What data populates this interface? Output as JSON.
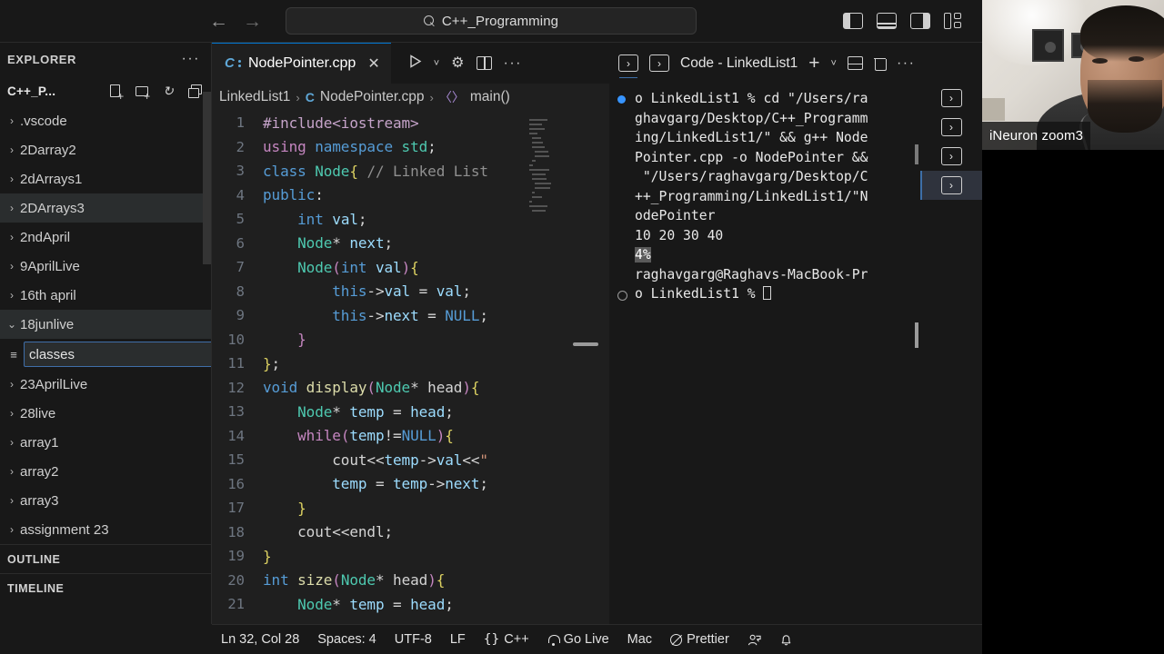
{
  "titlebar": {
    "back_label": "←",
    "forward_label": "→",
    "search_value": "C++_Programming",
    "search_icon": "search-icon",
    "layout_buttons": [
      "toggle-primary-sidebar",
      "toggle-panel",
      "toggle-secondary-sidebar",
      "customize-layout"
    ]
  },
  "sidebar": {
    "title": "EXPLORER",
    "more_label": "···",
    "project_name": "C++_P...",
    "actions": [
      "new-file",
      "new-folder",
      "refresh-explorer",
      "collapse-folders"
    ],
    "items": [
      {
        "label": ".vscode",
        "chevron": "›",
        "selected": false
      },
      {
        "label": "2Darray2",
        "chevron": "›",
        "selected": false
      },
      {
        "label": "2dArrays1",
        "chevron": "›",
        "selected": false
      },
      {
        "label": "2DArrays3",
        "chevron": "›",
        "selected": true
      },
      {
        "label": "2ndApril",
        "chevron": "›",
        "selected": false
      },
      {
        "label": "9AprilLive",
        "chevron": "›",
        "selected": false
      },
      {
        "label": "16th april",
        "chevron": "›",
        "selected": false
      },
      {
        "label": "18junlive",
        "chevron": "⌄",
        "selected": true
      }
    ],
    "new_item_input": {
      "value": "classes",
      "placeholder": "",
      "icon": "file-lines-icon"
    },
    "items_after": [
      {
        "label": "23AprilLive",
        "chevron": "›",
        "selected": false
      },
      {
        "label": "28live",
        "chevron": "›",
        "selected": false
      },
      {
        "label": "array1",
        "chevron": "›",
        "selected": false
      },
      {
        "label": "array2",
        "chevron": "›",
        "selected": false
      },
      {
        "label": "array3",
        "chevron": "›",
        "selected": false
      },
      {
        "label": "assignment 23",
        "chevron": "›",
        "selected": false
      }
    ],
    "sections": [
      "OUTLINE",
      "TIMELINE"
    ]
  },
  "editor": {
    "tab": {
      "label": "NodePointer.cpp",
      "icon": "cpp-file-icon",
      "close": "✕"
    },
    "actions": [
      "run-code",
      "run-dropdown",
      "settings-gear",
      "split-editor",
      "more-actions"
    ],
    "breadcrumb": [
      "LinkedList1",
      "NodePointer.cpp",
      "main()"
    ],
    "lines": [
      {
        "n": "1",
        "tokens": [
          {
            "t": "#include",
            "c": "k-pp"
          },
          {
            "t": "<iostream>",
            "c": "k-pp"
          }
        ]
      },
      {
        "n": "2",
        "tokens": [
          {
            "t": "using ",
            "c": "k-ctl"
          },
          {
            "t": "namespace ",
            "c": "k-kw"
          },
          {
            "t": "std",
            "c": "k-type"
          },
          {
            "t": ";",
            "c": "k-txt"
          }
        ]
      },
      {
        "n": "3",
        "tokens": [
          {
            "t": "class ",
            "c": "k-kw"
          },
          {
            "t": "Node",
            "c": "k-type"
          },
          {
            "t": "{",
            "c": "k-br"
          },
          {
            "t": " ",
            "c": "k-txt"
          },
          {
            "t": "// Linked List",
            "c": "k-cmt"
          }
        ]
      },
      {
        "n": "4",
        "tokens": [
          {
            "t": "public",
            "c": "k-kw"
          },
          {
            "t": ":",
            "c": "k-txt"
          }
        ]
      },
      {
        "n": "5",
        "tokens": [
          {
            "t": "    ",
            "c": "k-txt"
          },
          {
            "t": "int ",
            "c": "k-kw"
          },
          {
            "t": "val",
            "c": "k-var"
          },
          {
            "t": ";",
            "c": "k-txt"
          }
        ]
      },
      {
        "n": "6",
        "tokens": [
          {
            "t": "    ",
            "c": "k-txt"
          },
          {
            "t": "Node",
            "c": "k-type"
          },
          {
            "t": "* ",
            "c": "k-txt"
          },
          {
            "t": "next",
            "c": "k-var"
          },
          {
            "t": ";",
            "c": "k-txt"
          }
        ]
      },
      {
        "n": "7",
        "tokens": [
          {
            "t": "    ",
            "c": "k-txt"
          },
          {
            "t": "Node",
            "c": "k-type"
          },
          {
            "t": "(",
            "c": "k-br2"
          },
          {
            "t": "int ",
            "c": "k-kw"
          },
          {
            "t": "val",
            "c": "k-var"
          },
          {
            "t": ")",
            "c": "k-br2"
          },
          {
            "t": "{",
            "c": "k-br"
          }
        ]
      },
      {
        "n": "8",
        "tokens": [
          {
            "t": "        ",
            "c": "k-txt"
          },
          {
            "t": "this",
            "c": "k-kw"
          },
          {
            "t": "->",
            "c": "k-txt"
          },
          {
            "t": "val ",
            "c": "k-var"
          },
          {
            "t": "= ",
            "c": "k-txt"
          },
          {
            "t": "val",
            "c": "k-var"
          },
          {
            "t": ";",
            "c": "k-txt"
          }
        ]
      },
      {
        "n": "9",
        "tokens": [
          {
            "t": "        ",
            "c": "k-txt"
          },
          {
            "t": "this",
            "c": "k-kw"
          },
          {
            "t": "->",
            "c": "k-txt"
          },
          {
            "t": "next ",
            "c": "k-var"
          },
          {
            "t": "= ",
            "c": "k-txt"
          },
          {
            "t": "NULL",
            "c": "k-kw"
          },
          {
            "t": ";",
            "c": "k-txt"
          }
        ]
      },
      {
        "n": "10",
        "tokens": [
          {
            "t": "    ",
            "c": "k-txt"
          },
          {
            "t": "}",
            "c": "k-br2"
          }
        ]
      },
      {
        "n": "11",
        "tokens": [
          {
            "t": "}",
            "c": "k-br"
          },
          {
            "t": ";",
            "c": "k-txt"
          }
        ]
      },
      {
        "n": "12",
        "tokens": [
          {
            "t": "void ",
            "c": "k-kw"
          },
          {
            "t": "display",
            "c": "k-fn"
          },
          {
            "t": "(",
            "c": "k-br2"
          },
          {
            "t": "Node",
            "c": "k-type"
          },
          {
            "t": "* ",
            "c": "k-txt"
          },
          {
            "t": "head",
            "c": "k-txt"
          },
          {
            "t": ")",
            "c": "k-br2"
          },
          {
            "t": "{",
            "c": "k-br"
          }
        ]
      },
      {
        "n": "13",
        "tokens": [
          {
            "t": "    ",
            "c": "k-txt"
          },
          {
            "t": "Node",
            "c": "k-type"
          },
          {
            "t": "* ",
            "c": "k-txt"
          },
          {
            "t": "temp ",
            "c": "k-var"
          },
          {
            "t": "= ",
            "c": "k-txt"
          },
          {
            "t": "head",
            "c": "k-var"
          },
          {
            "t": ";",
            "c": "k-txt"
          }
        ]
      },
      {
        "n": "14",
        "tokens": [
          {
            "t": "    ",
            "c": "k-txt"
          },
          {
            "t": "while",
            "c": "k-ctl"
          },
          {
            "t": "(",
            "c": "k-br2"
          },
          {
            "t": "temp",
            "c": "k-var"
          },
          {
            "t": "!=",
            "c": "k-txt"
          },
          {
            "t": "NULL",
            "c": "k-kw"
          },
          {
            "t": ")",
            "c": "k-br2"
          },
          {
            "t": "{",
            "c": "k-br"
          }
        ]
      },
      {
        "n": "15",
        "tokens": [
          {
            "t": "        ",
            "c": "k-txt"
          },
          {
            "t": "cout",
            "c": "k-txt"
          },
          {
            "t": "<<",
            "c": "k-txt"
          },
          {
            "t": "temp",
            "c": "k-var"
          },
          {
            "t": "->",
            "c": "k-txt"
          },
          {
            "t": "val",
            "c": "k-var"
          },
          {
            "t": "<<",
            "c": "k-txt"
          },
          {
            "t": "\"",
            "c": "k-str"
          }
        ]
      },
      {
        "n": "16",
        "tokens": [
          {
            "t": "        ",
            "c": "k-txt"
          },
          {
            "t": "temp ",
            "c": "k-var"
          },
          {
            "t": "= ",
            "c": "k-txt"
          },
          {
            "t": "temp",
            "c": "k-var"
          },
          {
            "t": "->",
            "c": "k-txt"
          },
          {
            "t": "next",
            "c": "k-var"
          },
          {
            "t": ";",
            "c": "k-txt"
          }
        ]
      },
      {
        "n": "17",
        "tokens": [
          {
            "t": "    ",
            "c": "k-txt"
          },
          {
            "t": "}",
            "c": "k-br"
          }
        ]
      },
      {
        "n": "18",
        "tokens": [
          {
            "t": "    ",
            "c": "k-txt"
          },
          {
            "t": "cout",
            "c": "k-txt"
          },
          {
            "t": "<<",
            "c": "k-txt"
          },
          {
            "t": "endl",
            "c": "k-txt"
          },
          {
            "t": ";",
            "c": "k-txt"
          }
        ]
      },
      {
        "n": "19",
        "tokens": [
          {
            "t": "}",
            "c": "k-br"
          }
        ]
      },
      {
        "n": "20",
        "tokens": [
          {
            "t": "int ",
            "c": "k-kw"
          },
          {
            "t": "size",
            "c": "k-fn"
          },
          {
            "t": "(",
            "c": "k-br2"
          },
          {
            "t": "Node",
            "c": "k-type"
          },
          {
            "t": "* ",
            "c": "k-txt"
          },
          {
            "t": "head",
            "c": "k-txt"
          },
          {
            "t": ")",
            "c": "k-br2"
          },
          {
            "t": "{",
            "c": "k-br"
          }
        ]
      },
      {
        "n": "21",
        "tokens": [
          {
            "t": "    ",
            "c": "k-txt"
          },
          {
            "t": "Node",
            "c": "k-type"
          },
          {
            "t": "* ",
            "c": "k-txt"
          },
          {
            "t": "temp ",
            "c": "k-var"
          },
          {
            "t": "= ",
            "c": "k-txt"
          },
          {
            "t": "head",
            "c": "k-var"
          },
          {
            "t": ";",
            "c": "k-txt"
          }
        ]
      }
    ]
  },
  "terminal": {
    "tab_label": "Code - LinkedList1",
    "actions": [
      "new-terminal",
      "new-terminal-dropdown",
      "split-terminal",
      "kill-terminal",
      "terminal-more"
    ],
    "lines": [
      {
        "text": "o LinkedList1 % cd \"/Users/ra",
        "bullet": "filled"
      },
      {
        "text": "ghavgarg/Desktop/C++_Programm",
        "bullet": "none"
      },
      {
        "text": "ing/LinkedList1/\" && g++ Node",
        "bullet": "none"
      },
      {
        "text": "Pointer.cpp -o NodePointer &&",
        "bullet": "none"
      },
      {
        "text": " \"/Users/raghavgarg/Desktop/C",
        "bullet": "none"
      },
      {
        "text": "++_Programming/LinkedList1/\"N",
        "bullet": "none"
      },
      {
        "text": "odePointer",
        "bullet": "none"
      },
      {
        "text": "10 20 30 40",
        "bullet": "none"
      },
      {
        "text": "4%",
        "bullet": "none",
        "highlight": true
      },
      {
        "text": "raghavgarg@Raghavs-MacBook-Pr",
        "bullet": "none"
      },
      {
        "text": "o LinkedList1 % ",
        "bullet": "empty",
        "cursor": true
      }
    ],
    "instances": [
      {
        "label": "›",
        "active": false
      },
      {
        "label": "›",
        "active": false
      },
      {
        "label": "›",
        "active": false
      },
      {
        "label": "›",
        "active": true
      }
    ]
  },
  "statusbar": {
    "items": [
      {
        "label": "Ln 32, Col 28",
        "icon": ""
      },
      {
        "label": "Spaces: 4",
        "icon": ""
      },
      {
        "label": "UTF-8",
        "icon": ""
      },
      {
        "label": "LF",
        "icon": ""
      },
      {
        "label": "C++",
        "icon": "braces-icon"
      },
      {
        "label": "Go Live",
        "icon": "broadcast-icon"
      },
      {
        "label": "Mac",
        "icon": ""
      },
      {
        "label": "Prettier",
        "icon": "no-entry-icon"
      },
      {
        "label": "",
        "icon": "account-icon"
      },
      {
        "label": "",
        "icon": "bell-icon"
      }
    ]
  },
  "webcam": {
    "label": "iNeuron zoom3"
  }
}
